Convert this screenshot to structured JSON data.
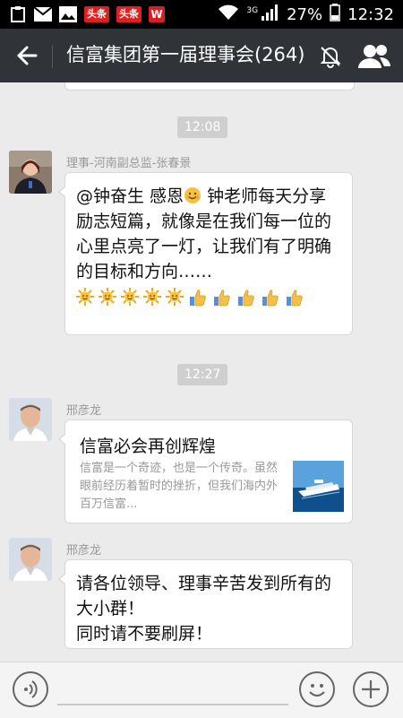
{
  "status_bar": {
    "news_badge_1": "头条",
    "news_badge_2": "头条",
    "wps_badge": "W",
    "network_type": "3G",
    "battery": "27%",
    "time": "12:32"
  },
  "app_bar": {
    "title": "信富集团第一届理事会(264)"
  },
  "messages": [
    {
      "time": "12:08",
      "sender": "理事-河南副总监-张春景",
      "text_line1": "@钟奋生 感恩",
      "text_rest": " 钟老师每天分享励志短篇，就像是在我们每一位的心里点亮了一灯，让我们有了明确的目标和方向……"
    },
    {
      "time": "12:27",
      "sender": "邢彦龙",
      "link_title": "信富必会再创辉煌",
      "link_desc": "信富是一个奇迹，也是一个传奇。虽然眼前经历着暂时的挫折，但我们海内外百万信富..."
    },
    {
      "sender": "邢彦龙",
      "text": "请各位领导、理事辛苦发到所有的大小群！\n同时请不要刷屏！"
    }
  ],
  "colors": {
    "app_bar": "#303337",
    "chat_background": "#ebebeb",
    "time_badge": "#cfcfcf"
  }
}
